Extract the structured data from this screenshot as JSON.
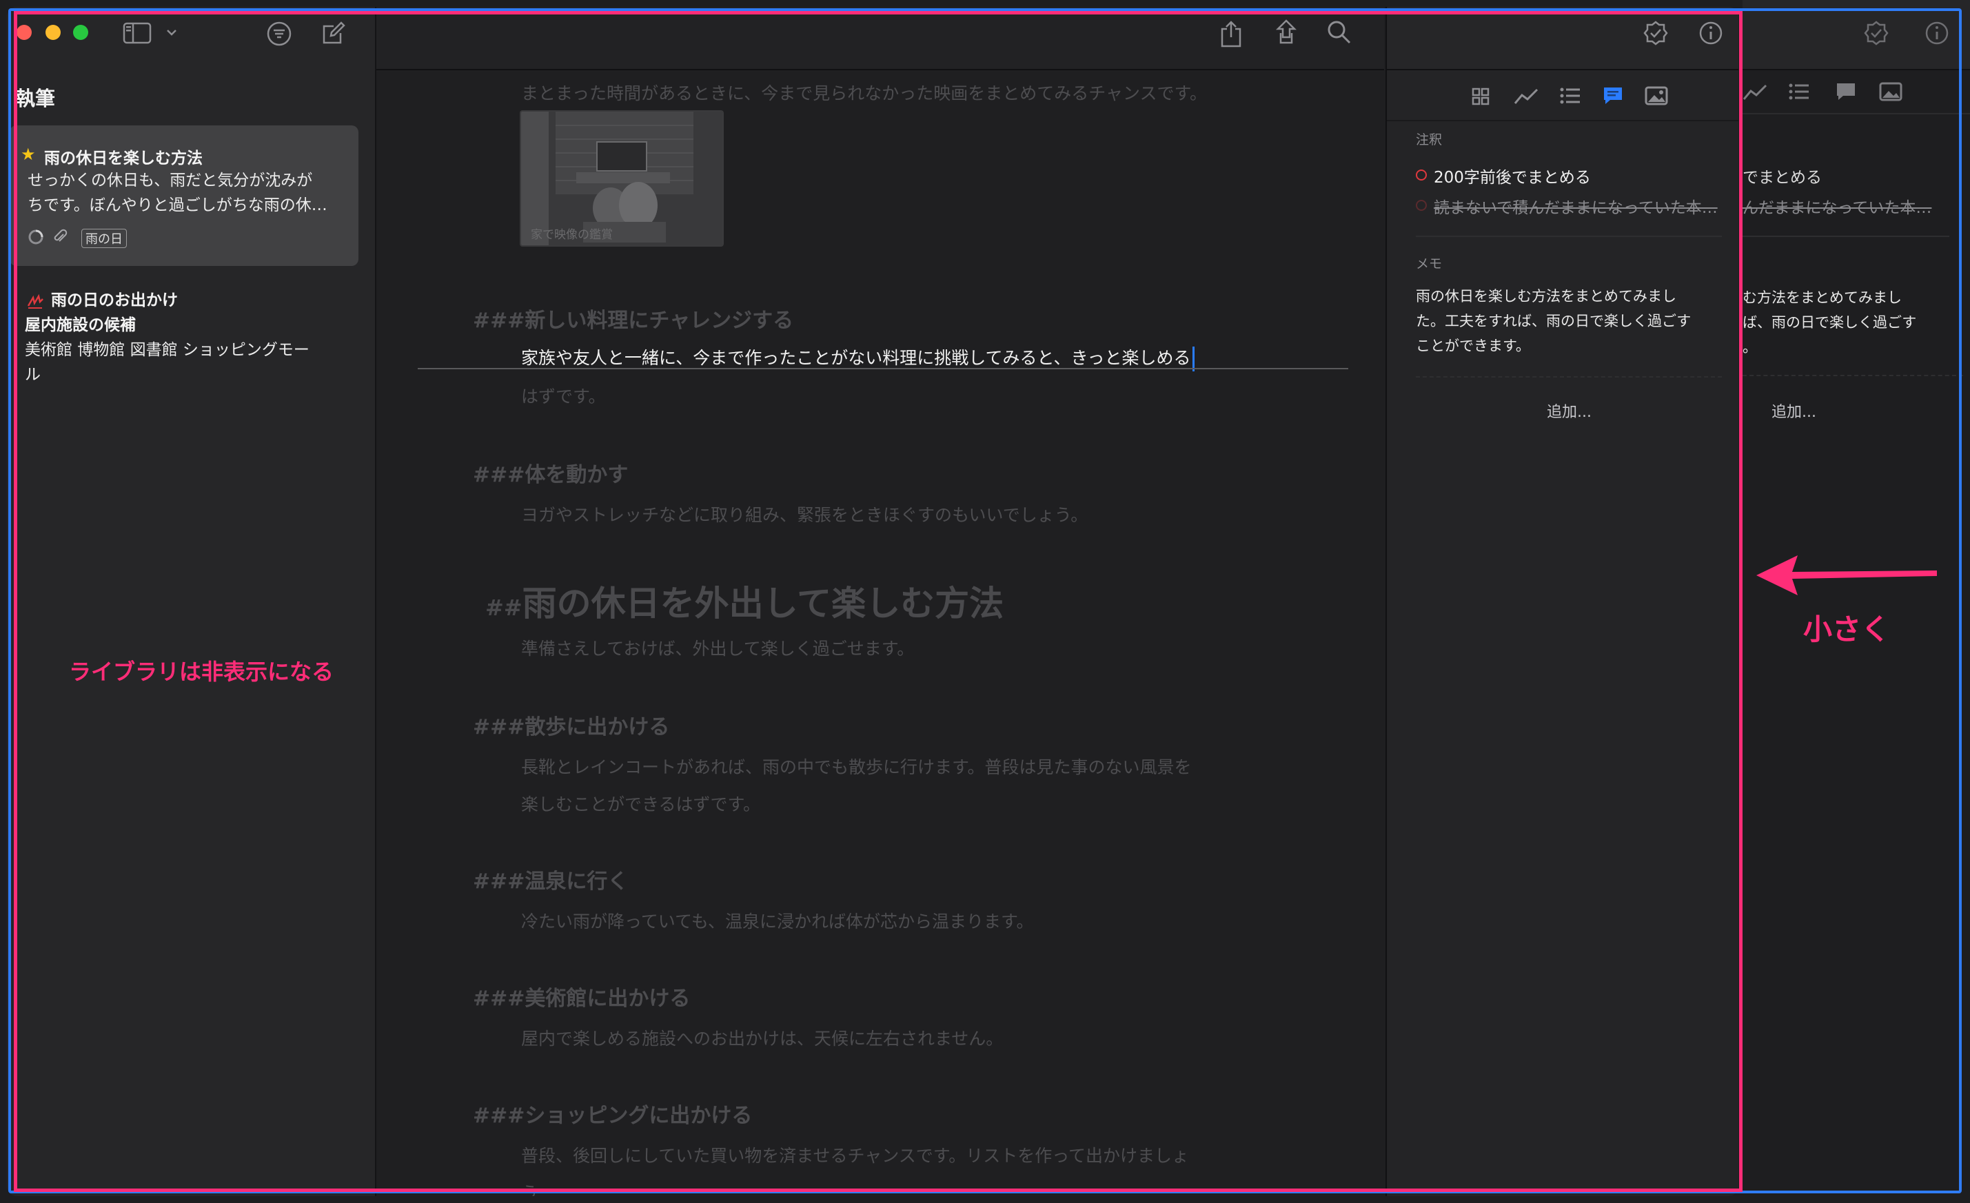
{
  "sidebar": {
    "title": "執筆",
    "notes": [
      {
        "title": "雨の休日を楽しむ方法",
        "line1": "せっかくの休日も、雨だと気分が沈みが",
        "line2": "ちです。ぼんやりと過ごしがちな雨の休…",
        "tag": "雨の日",
        "icon": "star-icon"
      },
      {
        "title": "雨の日のお出かけ",
        "line1": "屋内施設の候補",
        "line2": "美術館 博物館 図書館 ショッピングモー",
        "line3": "ル",
        "icon": "scribble-icon"
      }
    ]
  },
  "editor": {
    "intro_text": "まとまった時間があるときに、今まで見られなかった映画をまとめてみるチャンスです。",
    "image_caption": "家で映像の鑑賞",
    "sections": [
      {
        "mark": "###",
        "heading": "新しい料理にチャレンジする",
        "body_focus": "家族や友人と一緒に、今まで作ったことがない料理に挑戦してみると、きっと楽しめる",
        "body_cont": "はずです。"
      },
      {
        "mark": "###",
        "heading": "体を動かす",
        "body": "ヨガやストレッチなどに取り組み、緊張をときほぐすのもいいでしょう。"
      },
      {
        "mark": "##",
        "heading": "雨の休日を外出して楽しむ方法",
        "body": "準備さえしておけば、外出して楽しく過ごせます。"
      },
      {
        "mark": "###",
        "heading": "散歩に出かける",
        "body": "長靴とレインコートがあれば、雨の中でも散歩に行けます。普段は見た事のない風景を",
        "body_cont": "楽しむことができるはずです。"
      },
      {
        "mark": "###",
        "heading": "温泉に行く",
        "body": "冷たい雨が降っていても、温泉に浸かれば体が芯から温まります。"
      },
      {
        "mark": "###",
        "heading": "美術館に出かける",
        "body": "屋内で楽しめる施設へのお出かけは、天候に左右されません。"
      },
      {
        "mark": "###",
        "heading": "ショッピングに出かける",
        "body": "普段、後回しにしていた買い物を済ませるチャンスです。リストを作って出かけましょ",
        "body_cont": "う"
      }
    ]
  },
  "inspector": {
    "annotations_label": "注釈",
    "annotation_active": "200字前後でまとめる",
    "annotation_done": "読まないで積んだままになっていた本…",
    "memo_label": "メモ",
    "memo_line1": "雨の休日を楽しむ方法をまとめてみまし",
    "memo_line2": "た。工夫をすれば、雨の日で楽しく過ごす",
    "memo_line3": "ことができます。",
    "add_label": "追加..."
  },
  "ghost": {
    "annotation_active": "でまとめる",
    "annotation_done": "んだままになっていた本…",
    "memo_line1": "む方法をまとめてみまし",
    "memo_line2": "ば、雨の日で楽しく過ごす",
    "memo_line3": "。",
    "add_label": "追加..."
  },
  "overlay": {
    "library_hidden": "ライブラリは非表示になる",
    "smaller": "小さく"
  },
  "colors": {
    "accent_pink": "#ff2d78",
    "accent_blue": "#2f7cf6",
    "tab_active": "#2a7cff"
  }
}
